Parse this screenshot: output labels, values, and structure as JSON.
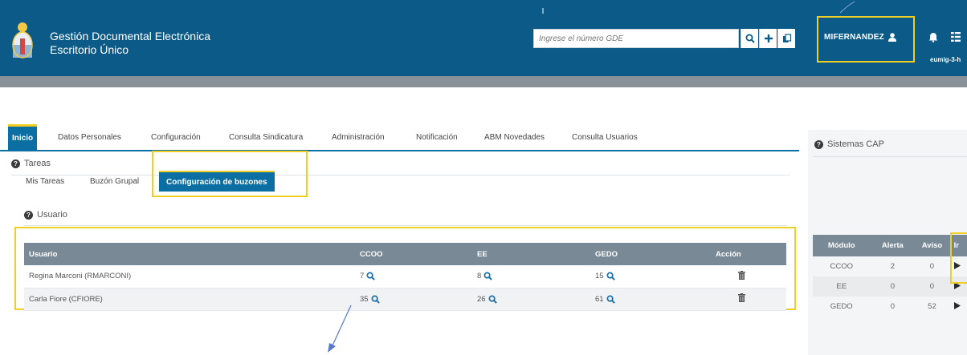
{
  "header": {
    "title_line1": "Gestión Documental Electrónica",
    "title_line2": "Escritorio Único",
    "search_placeholder": "Ingrese el número GDE",
    "username": "MIFERNANDEZ",
    "env_label": "eumig-3-h"
  },
  "nav": {
    "tabs": [
      "Inicio",
      "Datos Personales",
      "Configuración",
      "Consulta Sindicatura",
      "Administración",
      "Notificación",
      "ABM Novedades",
      "Consulta Usuarios"
    ],
    "active": "Inicio"
  },
  "tareas": {
    "heading": "Tareas",
    "subtabs": [
      "Mis Tareas",
      "Buzón Grupal",
      "Configuración de buzones"
    ],
    "active_subtab": "Configuración de buzones",
    "usuario_heading": "Usuario",
    "table": {
      "columns": [
        "Usuario",
        "CCOO",
        "EE",
        "GEDO",
        "Acción"
      ],
      "rows": [
        {
          "usuario": "Regina Marconi (RMARCONI)",
          "ccoo": "7",
          "ee": "8",
          "gedo": "15"
        },
        {
          "usuario": "Carla Fiore (CFIORE)",
          "ccoo": "35",
          "ee": "26",
          "gedo": "61"
        }
      ]
    }
  },
  "cap": {
    "heading": "Sistemas CAP",
    "columns": [
      "Módulo",
      "Alerta",
      "Aviso",
      "Ir"
    ],
    "rows": [
      {
        "modulo": "CCOO",
        "alerta": "2",
        "aviso": "0"
      },
      {
        "modulo": "EE",
        "alerta": "0",
        "aviso": "0"
      },
      {
        "modulo": "GEDO",
        "alerta": "0",
        "aviso": "52"
      }
    ]
  },
  "colors": {
    "header_bg": "#0c5a87",
    "accent": "#0c6fa3",
    "highlight": "#f0cf22",
    "table_header": "#7a8996",
    "annotation_arrow": "#5878c8"
  },
  "icons": [
    "search-icon",
    "plus-icon",
    "documents-icon",
    "user-icon",
    "bell-icon",
    "grid-icon",
    "question-icon",
    "magnifier-icon",
    "trash-icon",
    "play-icon",
    "coat-of-arms-icon"
  ]
}
